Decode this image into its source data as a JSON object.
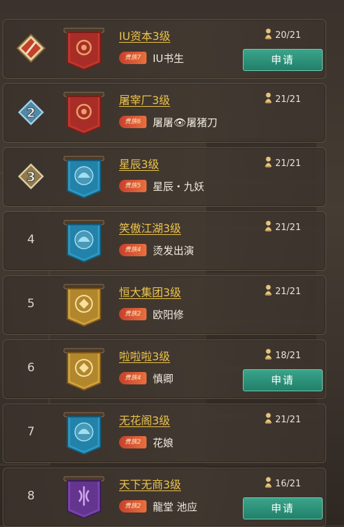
{
  "rows": [
    {
      "rank": "1",
      "name": "IU资本3级",
      "vip": "贵族7",
      "leader": "IU书生",
      "members": "20/21",
      "apply": "申请",
      "banner": "red",
      "badge": "pen"
    },
    {
      "rank": "2",
      "name": "屠宰厂3级",
      "vip": "贵族6",
      "leader": "屠屠👁屠猪刀",
      "members": "21/21",
      "apply": "",
      "banner": "red",
      "badge": "diamond-blue"
    },
    {
      "rank": "3",
      "name": "星辰3级",
      "vip": "贵族5",
      "leader": "星辰・九妖",
      "members": "21/21",
      "apply": "",
      "banner": "blue",
      "badge": "diamond-gold"
    },
    {
      "rank": "4",
      "name": "笑傲江湖3级",
      "vip": "贵族4",
      "leader": "烫发出演",
      "members": "21/21",
      "apply": "",
      "banner": "blue",
      "badge": ""
    },
    {
      "rank": "5",
      "name": "恒大集团3级",
      "vip": "贵族2",
      "leader": "欧阳修",
      "members": "21/21",
      "apply": "",
      "banner": "gold",
      "badge": ""
    },
    {
      "rank": "6",
      "name": "啦啦啦3级",
      "vip": "贵族4",
      "leader": "慎卿",
      "members": "18/21",
      "apply": "申请",
      "banner": "gold",
      "badge": ""
    },
    {
      "rank": "7",
      "name": "无花阁3级",
      "vip": "贵族2",
      "leader": "花娘",
      "members": "21/21",
      "apply": "",
      "banner": "blue",
      "badge": ""
    },
    {
      "rank": "8",
      "name": "天下无商3级",
      "vip": "贵族2",
      "leader": "龍堂 池应",
      "members": "16/21",
      "apply": "申请",
      "banner": "purple",
      "badge": ""
    }
  ],
  "colors": {
    "red": "#b8352e",
    "blue": "#2a8fb8",
    "gold": "#c8962e",
    "purple": "#6a3a9a",
    "accent": "#ecc34a",
    "apply": "#2a9478"
  },
  "icons": {
    "members": "person-pin-icon",
    "rank1": "pen-diamond-icon",
    "rank2": "diamond-2-icon",
    "rank3": "diamond-3-icon"
  }
}
